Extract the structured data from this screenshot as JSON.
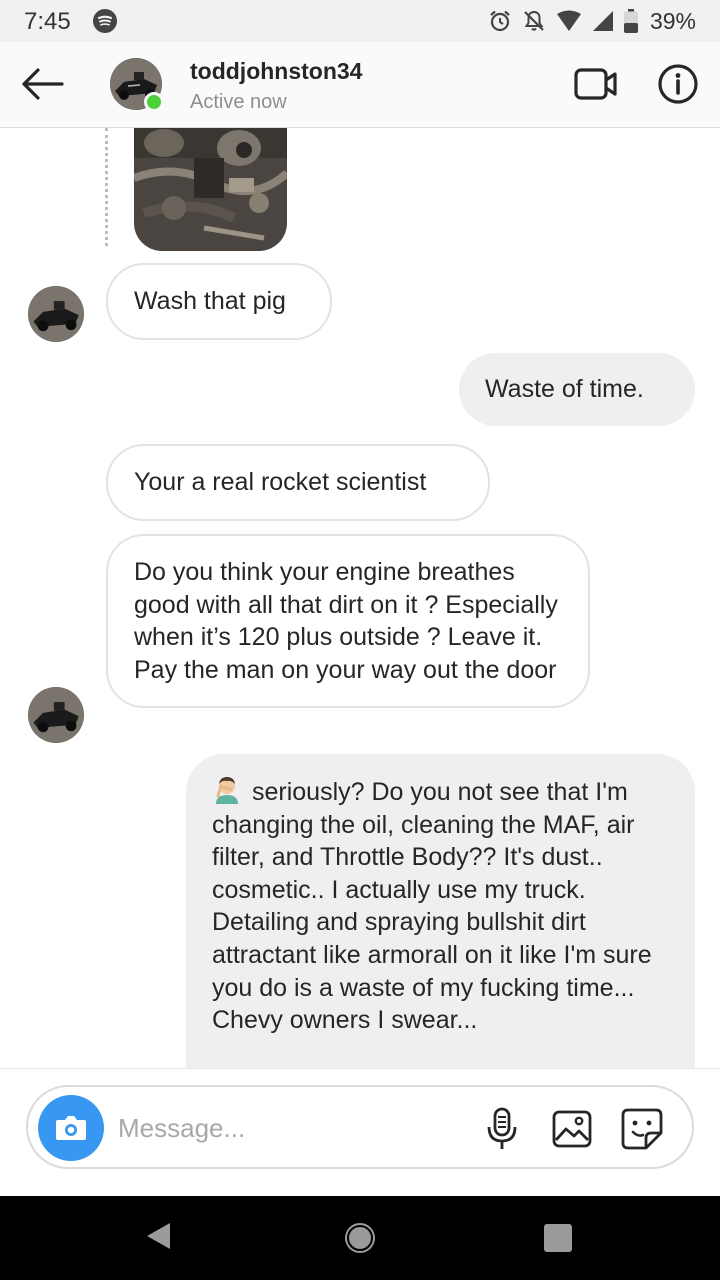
{
  "status_bar": {
    "time": "7:45",
    "battery": "39%"
  },
  "header": {
    "username": "toddjohnston34",
    "status": "Active now"
  },
  "messages": [
    {
      "from": "them",
      "text": "Wash that pig"
    },
    {
      "from": "me",
      "text": "Waste of time."
    },
    {
      "from": "them",
      "text": "Your a real rocket scientist"
    },
    {
      "from": "them",
      "text": "Do you think your engine breathes good with all that dirt on it ? Especially when it’s 120 plus outside ? Leave it. Pay the man on your way out the door"
    },
    {
      "from": "me",
      "emoji": "facepalm",
      "text": "seriously? Do you not see that I'm changing the oil, cleaning the MAF, air filter, and Throttle Body?? It's dust.. cosmetic..  I actually use my truck. Detailing and spraying bullshit dirt attractant like armorall on it like I'm sure you do is a waste of my fucking time... Chevy owners I swear..."
    }
  ],
  "composer": {
    "placeholder": "Message..."
  },
  "colors": {
    "accent": "#3897f0",
    "online": "#4cd137",
    "sent_bubble": "#efefef",
    "received_border": "#e3e3e3"
  }
}
